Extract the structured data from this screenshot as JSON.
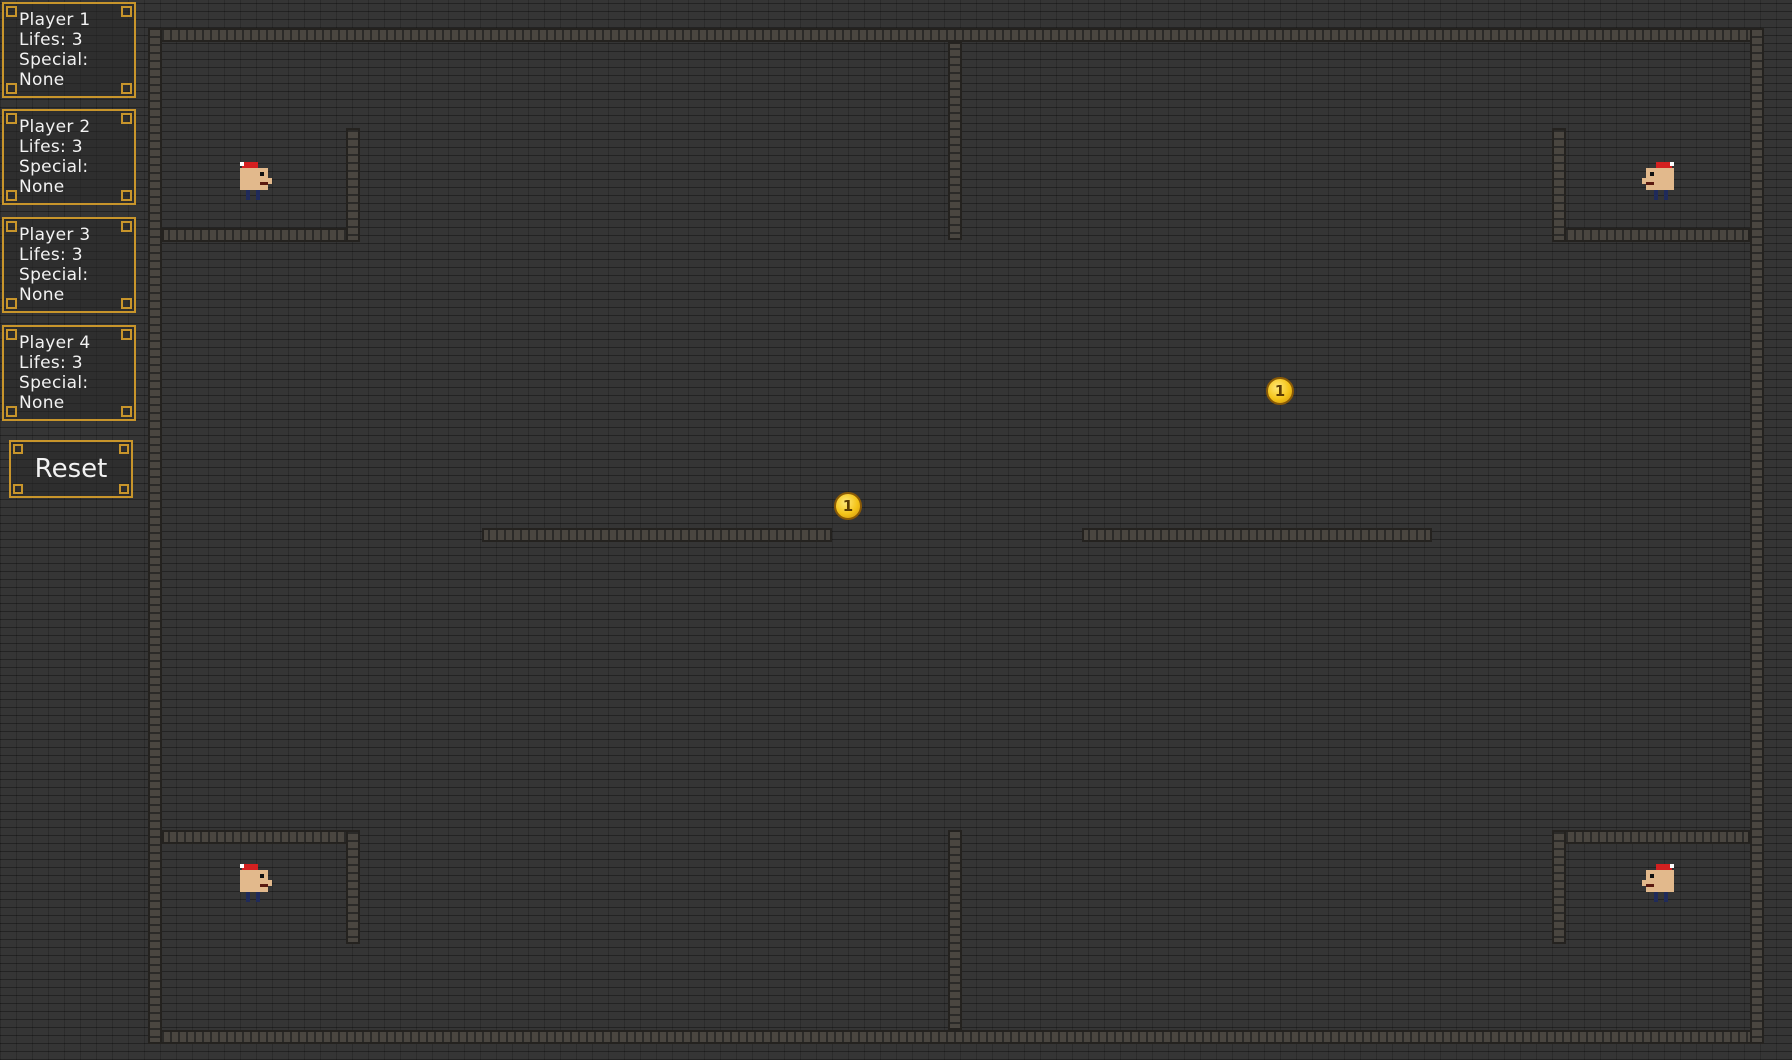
{
  "players": [
    {
      "name": "Player 1",
      "lives": "Lifes: 3",
      "special_label": "Special:",
      "special_value": "None"
    },
    {
      "name": "Player 2",
      "lives": "Lifes: 3",
      "special_label": "Special:",
      "special_value": "None"
    },
    {
      "name": "Player 3",
      "lives": "Lifes: 3",
      "special_label": "Special:",
      "special_value": "None"
    },
    {
      "name": "Player 4",
      "lives": "Lifes: 3",
      "special_label": "Special:",
      "special_value": "None"
    }
  ],
  "reset_label": "Reset",
  "coins": [
    {
      "value": "1"
    },
    {
      "value": "1"
    }
  ],
  "colors": {
    "accent": "#c8952b",
    "background": "#353535",
    "coin": "#f4c419",
    "hat": "#d42020",
    "skin": "#e2b98c"
  },
  "icons": {
    "player": "player-sprite-icon",
    "coin": "coin-icon"
  }
}
